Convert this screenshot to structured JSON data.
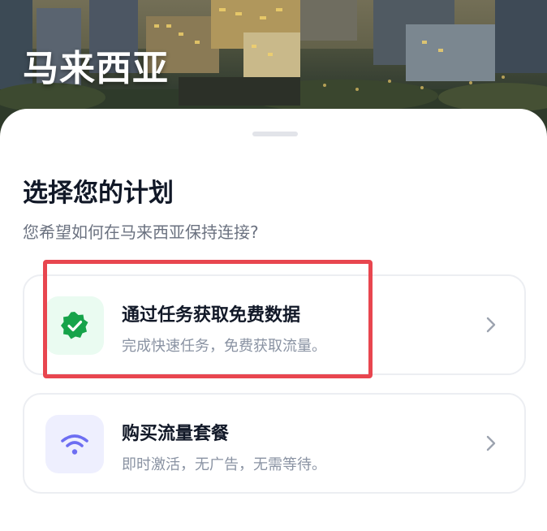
{
  "hero": {
    "country": "马来西亚"
  },
  "plan": {
    "title": "选择您的计划",
    "subtitle": "您希望如何在马来西亚保持连接?"
  },
  "options": [
    {
      "title": "通过任务获取免费数据",
      "description": "完成快速任务，免费获取流量。",
      "icon": "verified-check-badge-icon",
      "icon_color": "#16a34a",
      "icon_bg": "#eafbf1"
    },
    {
      "title": "购买流量套餐",
      "description": "即时激活，无广告，无需等待。",
      "icon": "wifi-icon",
      "icon_color": "#6d6ef2",
      "icon_bg": "#eeeffe"
    }
  ],
  "colors": {
    "highlight": "#e8464f"
  }
}
